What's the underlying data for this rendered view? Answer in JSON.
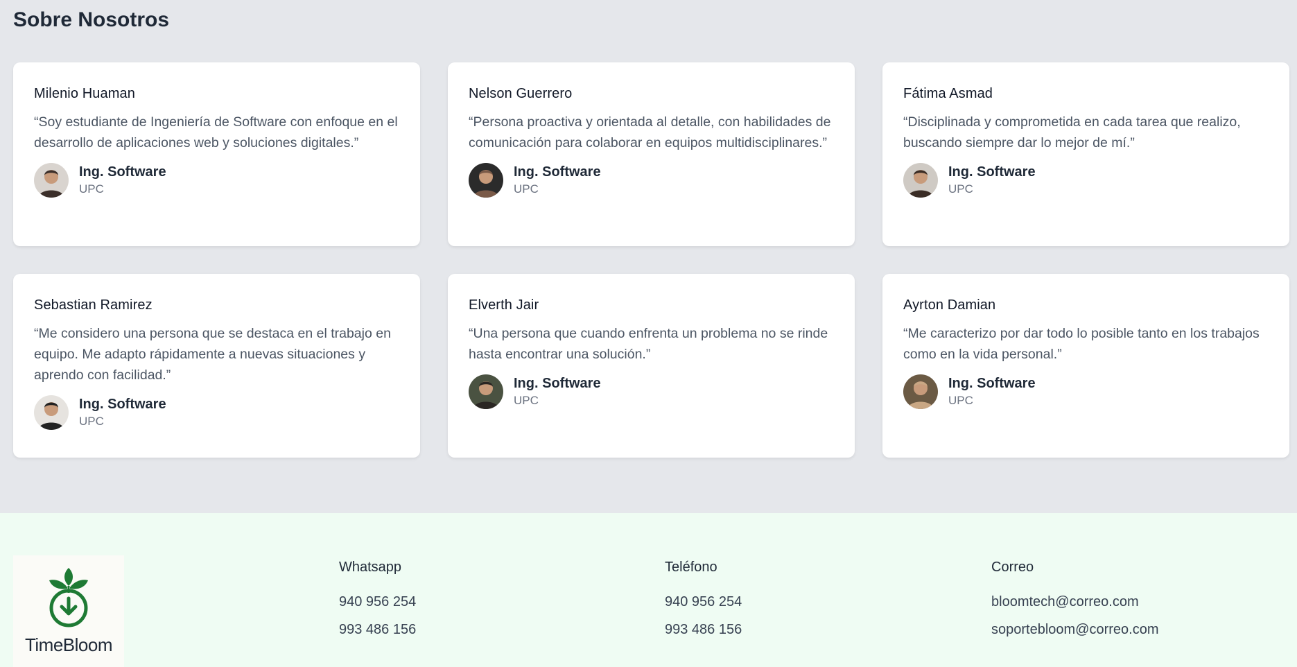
{
  "about": {
    "title": "Sobre Nosotros",
    "cards": [
      {
        "name": "Milenio Huaman",
        "quote": "“Soy estudiante de Ingeniería de Software con enfoque en el desarrollo de aplicaciones web y soluciones digitales.”",
        "role": "Ing. Software",
        "org": "UPC",
        "avatar_bg": "#d9d4cf",
        "avatar_fg": "#3b2f2a"
      },
      {
        "name": "Nelson Guerrero",
        "quote": "“Persona proactiva y orientada al detalle, con habilidades de comunicación para colaborar en equipos multidisciplinares.”",
        "role": "Ing. Software",
        "org": "UPC",
        "avatar_bg": "#2b2b2b",
        "avatar_fg": "#7a5a48"
      },
      {
        "name": "Fátima Asmad",
        "quote": "“Disciplinada y comprometida en cada tarea que realizo, buscando siempre dar lo mejor de mí.”",
        "role": "Ing. Software",
        "org": "UPC",
        "avatar_bg": "#cfcac4",
        "avatar_fg": "#3a2c25"
      },
      {
        "name": "Sebastian Ramirez",
        "quote": "“Me considero una persona que se destaca en el trabajo en equipo. Me adapto rápidamente a nuevas situaciones y aprendo con facilidad.”",
        "role": "Ing. Software",
        "org": "UPC",
        "avatar_bg": "#e6e3df",
        "avatar_fg": "#222222"
      },
      {
        "name": "Elverth Jair",
        "quote": "“Una persona que cuando enfrenta un problema no se rinde hasta encontrar una solución.”",
        "role": "Ing. Software",
        "org": "UPC",
        "avatar_bg": "#4a5241",
        "avatar_fg": "#2a2623"
      },
      {
        "name": "Ayrton Damian",
        "quote": "“Me caracterizo por dar todo lo posible tanto en los trabajos como en la vida personal.”",
        "role": "Ing. Software",
        "org": "UPC",
        "avatar_bg": "#6b5a44",
        "avatar_fg": "#c9a784"
      }
    ]
  },
  "footer": {
    "logo_text": "TimeBloom",
    "logo_icon": "sprout-clock-icon",
    "brand_color": "#1e7a34",
    "columns": [
      {
        "title": "Whatsapp",
        "items": [
          "940 956 254",
          "993 486 156"
        ]
      },
      {
        "title": "Teléfono",
        "items": [
          "940 956 254",
          "993 486 156"
        ]
      },
      {
        "title": "Correo",
        "items": [
          "bloomtech@correo.com",
          "soportebloom@correo.com"
        ]
      }
    ]
  }
}
